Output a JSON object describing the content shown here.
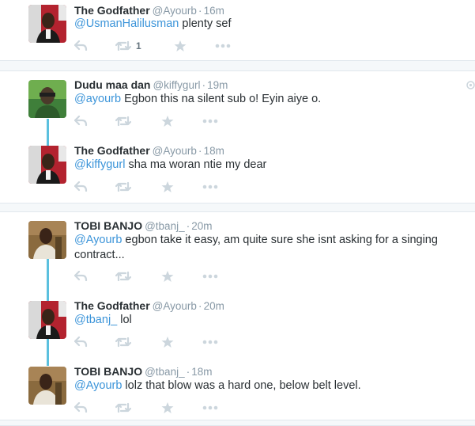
{
  "colors": {
    "accent": "#3b94d9",
    "thread": "#5bc0de",
    "muted": "#8899a6"
  },
  "icons": {
    "reply": "reply-icon",
    "retweet": "retweet-icon",
    "favorite": "star-icon",
    "more": "more-icon"
  },
  "tweets": [
    {
      "name": "The Godfather",
      "handle": "@Ayourb",
      "sep": "·",
      "time": "16m",
      "mention": "@UsmanHalilusman",
      "text": " plenty sef",
      "text2": "",
      "retweet_count": "1"
    },
    {
      "name": "Dudu maa dan",
      "handle": "@kiffygurl",
      "sep": "·",
      "time": "19m",
      "mention": "@ayourb",
      "text": " Egbon this na silent sub o! Eyin aiye o.",
      "text2": "",
      "retweet_count": ""
    },
    {
      "name": "The Godfather",
      "handle": "@Ayourb",
      "sep": "·",
      "time": "18m",
      "mention": "@kiffygurl",
      "text": " sha ma woran ntie my dear",
      "text2": "",
      "retweet_count": ""
    },
    {
      "name": "TOBI BANJO",
      "handle": "@tbanj_",
      "sep": "·",
      "time": "20m",
      "mention": "@Ayourb",
      "text": " egbon take it easy, am quite sure she isnt asking for a singing",
      "text2": "contract...",
      "retweet_count": ""
    },
    {
      "name": "The Godfather",
      "handle": "@Ayourb",
      "sep": "·",
      "time": "20m",
      "mention": "@tbanj_",
      "text": " lol",
      "text2": "",
      "retweet_count": ""
    },
    {
      "name": "TOBI BANJO",
      "handle": "@tbanj_",
      "sep": "·",
      "time": "18m",
      "mention": "@Ayourb",
      "text": " lolz that blow was a hard one, below belt level.",
      "text2": "",
      "retweet_count": ""
    }
  ]
}
